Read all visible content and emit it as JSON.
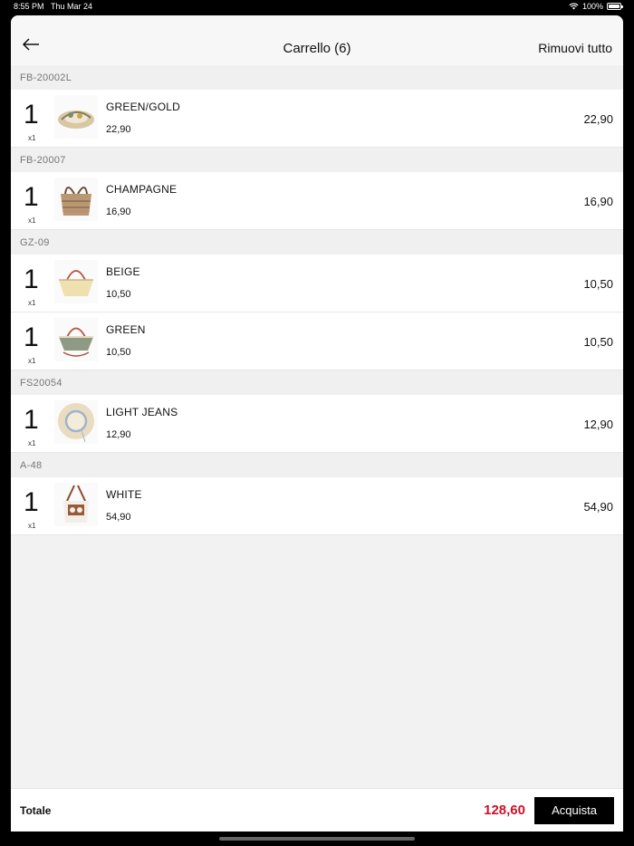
{
  "status": {
    "time": "8:55 PM",
    "date": "Thu Mar 24",
    "battery": "100%",
    "battery_level": 1.0
  },
  "nav": {
    "title": "Carrello (6)",
    "clear_label": "Rimuovi tutto"
  },
  "groups": [
    {
      "code": "FB-20002L",
      "items": [
        {
          "qty": "1",
          "mult": "x1",
          "name": "GREEN/GOLD",
          "unit_price": "22,90",
          "total": "22,90"
        }
      ]
    },
    {
      "code": "FB-20007",
      "items": [
        {
          "qty": "1",
          "mult": "x1",
          "name": "CHAMPAGNE",
          "unit_price": "16,90",
          "total": "16,90"
        }
      ]
    },
    {
      "code": "GZ-09",
      "items": [
        {
          "qty": "1",
          "mult": "x1",
          "name": "BEIGE",
          "unit_price": "10,50",
          "total": "10,50"
        },
        {
          "qty": "1",
          "mult": "x1",
          "name": "GREEN",
          "unit_price": "10,50",
          "total": "10,50"
        }
      ]
    },
    {
      "code": "FS20054",
      "items": [
        {
          "qty": "1",
          "mult": "x1",
          "name": "LIGHT JEANS",
          "unit_price": "12,90",
          "total": "12,90"
        }
      ]
    },
    {
      "code": "A-48",
      "items": [
        {
          "qty": "1",
          "mult": "x1",
          "name": "WHITE",
          "unit_price": "54,90",
          "total": "54,90"
        }
      ]
    }
  ],
  "footer": {
    "total_label": "Totale",
    "total_value": "128,60",
    "buy_label": "Acquista"
  },
  "colors": {
    "accent_red": "#d0102a",
    "buy_button": "#000000"
  }
}
